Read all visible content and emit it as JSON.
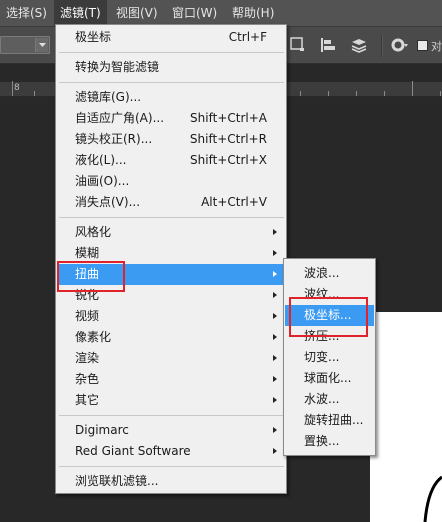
{
  "menubar": {
    "items": [
      "选择(S)",
      "滤镜(T)",
      "视图(V)",
      "窗口(W)",
      "帮助(H)"
    ],
    "active_index": 1
  },
  "ruler": {
    "label": "8"
  },
  "filter_menu": {
    "items": [
      {
        "label": "极坐标",
        "shortcut": "Ctrl+F"
      },
      {
        "label": "转换为智能滤镜",
        "shortcut": ""
      },
      {
        "label": "滤镜库(G)...",
        "shortcut": ""
      },
      {
        "label": "自适应广角(A)...",
        "shortcut": "Shift+Ctrl+A"
      },
      {
        "label": "镜头校正(R)...",
        "shortcut": "Shift+Ctrl+R"
      },
      {
        "label": "液化(L)...",
        "shortcut": "Shift+Ctrl+X"
      },
      {
        "label": "油画(O)...",
        "shortcut": ""
      },
      {
        "label": "消失点(V)...",
        "shortcut": "Alt+Ctrl+V"
      },
      {
        "label": "风格化",
        "shortcut": ""
      },
      {
        "label": "模糊",
        "shortcut": ""
      },
      {
        "label": "扭曲",
        "shortcut": ""
      },
      {
        "label": "锐化",
        "shortcut": ""
      },
      {
        "label": "视频",
        "shortcut": ""
      },
      {
        "label": "像素化",
        "shortcut": ""
      },
      {
        "label": "渲染",
        "shortcut": ""
      },
      {
        "label": "杂色",
        "shortcut": ""
      },
      {
        "label": "其它",
        "shortcut": ""
      },
      {
        "label": "Digimarc",
        "shortcut": ""
      },
      {
        "label": "Red Giant Software",
        "shortcut": ""
      },
      {
        "label": "浏览联机滤镜...",
        "shortcut": ""
      }
    ],
    "highlighted": "扭曲"
  },
  "distort_submenu": {
    "items": [
      "波浪...",
      "波纹...",
      "极坐标...",
      "挤压...",
      "切变...",
      "球面化...",
      "水波...",
      "旋转扭曲...",
      "置换..."
    ],
    "highlighted": "极坐标..."
  },
  "colors": {
    "highlight": "#3b9af2",
    "annotation": "#e0222a",
    "menu_bg": "#f0f0f0"
  }
}
